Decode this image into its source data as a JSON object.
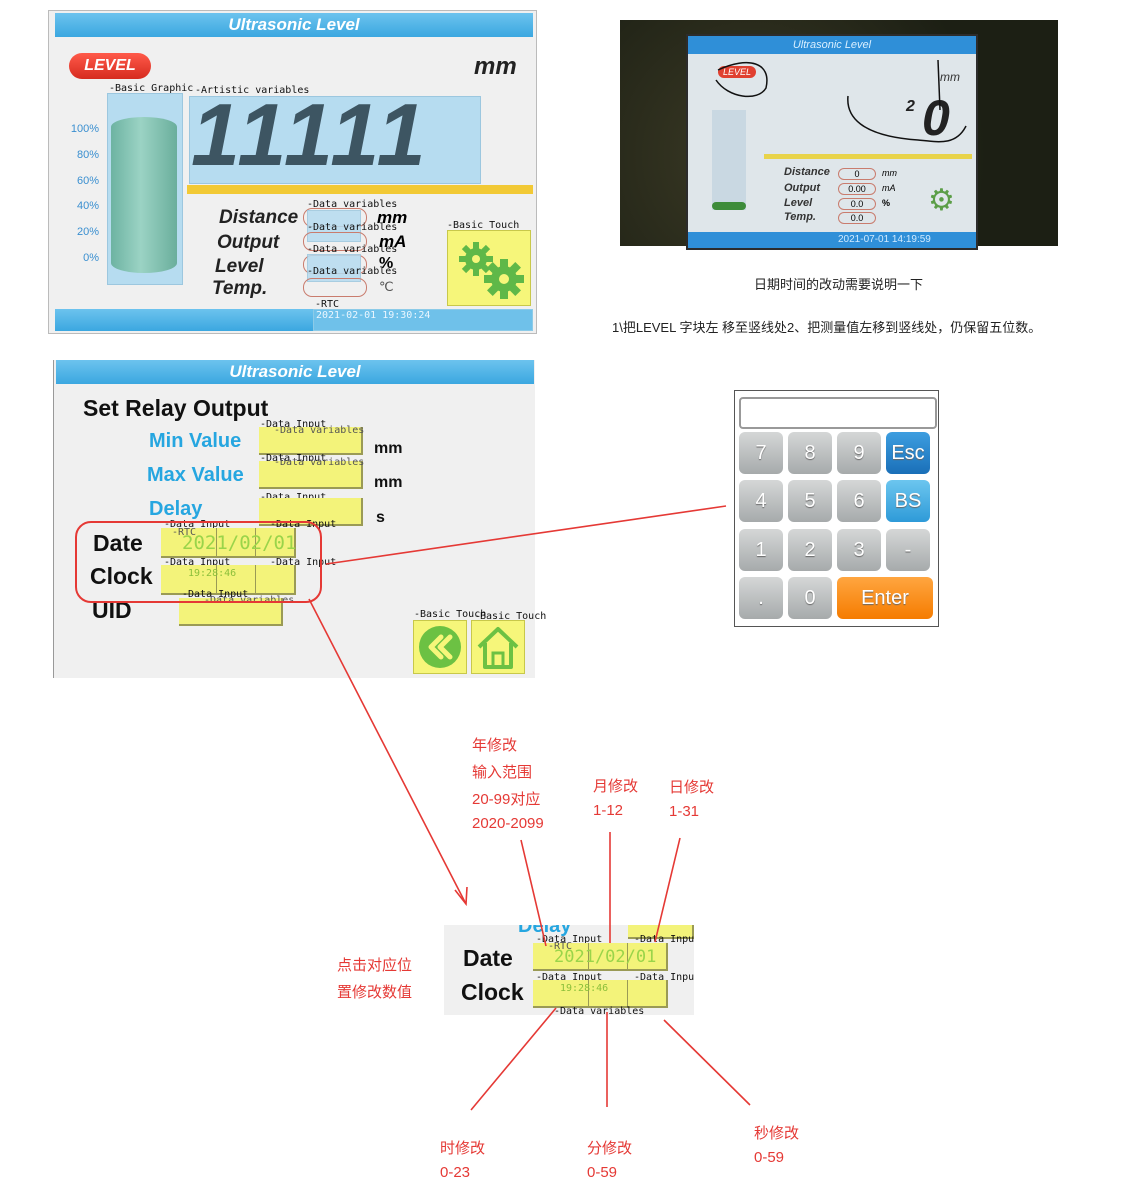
{
  "panel1": {
    "title": "Ultrasonic    Level",
    "level_badge": "LEVEL",
    "unit_mm": "mm",
    "big_value": "11111",
    "y_ticks": [
      "100%",
      "80%",
      "60%",
      "40%",
      "20%",
      "0%"
    ],
    "labels": {
      "distance": "Distance",
      "output": "Output",
      "level": "Level",
      "temp": "Temp."
    },
    "units": {
      "distance": "mm",
      "output": "mA",
      "level": "%",
      "temp": "℃"
    },
    "rtc_text": "2021-02-01 19:30:24",
    "tags": {
      "basic_graphic": "-Basic Graphic",
      "artistic": "-Artistic variables",
      "data_vars": "-Data variables",
      "basic_touch": "-Basic Touch",
      "rtc": "-RTC"
    }
  },
  "photo": {
    "title": "Ultrasonic    Level",
    "badge": "LEVEL",
    "unit": "mm",
    "value": "0",
    "annot": "2",
    "labels": [
      "Distance",
      "Output",
      "Level",
      "Temp."
    ],
    "values": [
      "0",
      "0.00",
      "0.0",
      "0.0"
    ],
    "units": [
      "mm",
      "mA",
      "%",
      ""
    ],
    "datetime": "2021-07-01  14:19:59"
  },
  "notes": {
    "line1": "日期时间的改动需要说明一下",
    "line2": "1\\把LEVEL 字块左 移至竖线处2、把测量值左移到竖线处，仍保留五位数。"
  },
  "panel2": {
    "title": "Ultrasonic    Level",
    "heading": "Set Relay Output",
    "min_label": "Min Value",
    "max_label": "Max Value",
    "delay_label": "Delay",
    "unit_mm1": "mm",
    "unit_mm2": "mm",
    "unit_s": "s",
    "date_label": "Date",
    "clock_label": "Clock",
    "uid_label": "UID",
    "date_value": "2021/02/01",
    "time_value": "19:28:46",
    "tags": {
      "data_input": "-Data Input",
      "data_variables": "-Data variables",
      "rtc": "-RTC",
      "basic_touch": "-Basic Touch"
    }
  },
  "keypad": {
    "keys": [
      "7",
      "8",
      "9",
      "Esc",
      "4",
      "5",
      "6",
      "BS",
      "1",
      "2",
      "3",
      "-",
      ".",
      "0",
      "Enter"
    ]
  },
  "zoom": {
    "delay_label": "Delay",
    "date_label": "Date",
    "clock_label": "Clock",
    "date_value": "2021/02/01",
    "time_value": "19:28:46",
    "tag_data_input": "-Data Input",
    "tag_data_variables": "-Data variables",
    "tag_rtc": "-RTC"
  },
  "annotations": {
    "year": [
      "年修改",
      "输入范围",
      "20-99对应",
      "2020-2099"
    ],
    "month": [
      "月修改",
      "1-12"
    ],
    "day": [
      "日修改",
      "1-31"
    ],
    "click": [
      "点击对应位",
      "置修改数值"
    ],
    "hour": [
      "时修改",
      "0-23"
    ],
    "minute": [
      "分修改",
      "0-59"
    ],
    "second": [
      "秒修改",
      "0-59"
    ]
  },
  "colors": {
    "accent": "#3ba7e0",
    "annotation": "#e53935",
    "input_fill": "#f6f67a",
    "tank": "#7bbfae"
  }
}
